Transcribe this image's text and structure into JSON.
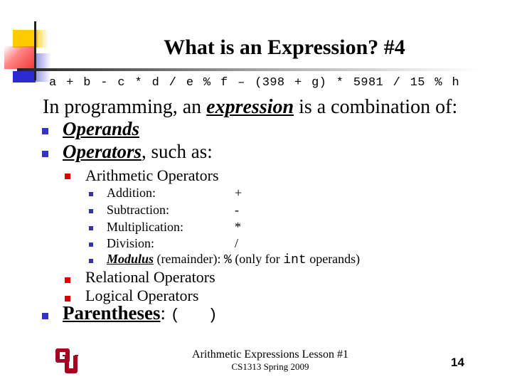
{
  "slide": {
    "title": "What is an Expression? #4",
    "code_example": "a + b - c * d / e % f – (398 + g) * 5981 / 15 % h",
    "intro": {
      "before": "In programming, an ",
      "emphasis": "expression",
      "after": " is a combination of:"
    },
    "bullets": {
      "operands": "Operands",
      "operators": "Operators",
      "operators_suffix": ", such as:",
      "arithmetic": "Arithmetic Operators",
      "arithmetic_items": [
        {
          "label": "Addition:",
          "symbol": "+"
        },
        {
          "label": "Subtraction:",
          "symbol": "-"
        },
        {
          "label": "Multiplication:",
          "symbol": "*"
        },
        {
          "label": "Division:",
          "symbol": "/"
        }
      ],
      "modulus": {
        "label": "Modulus",
        "suffix": " (remainder): ",
        "symbol": "%",
        "note_before": " (only for ",
        "note_code": "int",
        "note_after": " operands)"
      },
      "relational": "Relational Operators",
      "logical": "Logical Operators",
      "parentheses": "Parentheses",
      "parentheses_suffix": ":",
      "parentheses_symbols": "(   )"
    },
    "footer": {
      "title": "Arithmetic Expressions Lesson #1",
      "subtitle": "CS1313 Spring 2009",
      "page_number": "14"
    },
    "colors": {
      "level1_bullet": "#3333cc",
      "level2_bullet": "#dd0000",
      "level3_bullet": "#3333aa",
      "logo": "#a50021"
    }
  }
}
